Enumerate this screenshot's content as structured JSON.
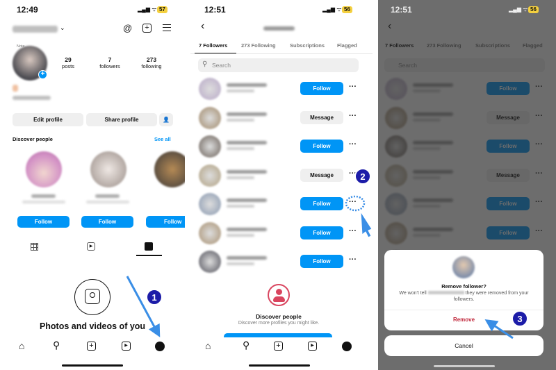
{
  "panel1": {
    "status": {
      "time": "12:49",
      "battery": "57"
    },
    "header_icons": [
      "threads-icon",
      "new-post-icon",
      "menu-icon"
    ],
    "avatar_note": "Note...",
    "stats": [
      {
        "value": "29",
        "label": "posts"
      },
      {
        "value": "7",
        "label": "followers"
      },
      {
        "value": "273",
        "label": "following"
      }
    ],
    "edit_profile": "Edit profile",
    "share_profile": "Share profile",
    "discover_title": "Discover people",
    "see_all": "See all",
    "suggestion_follow": "Follow",
    "content_tabs": [
      "grid-icon",
      "reels-icon",
      "tagged-icon"
    ],
    "tagged_empty": "Photos and videos of you",
    "step": "1"
  },
  "panel2": {
    "status": {
      "time": "12:51",
      "battery": "56"
    },
    "tabs": [
      "7 Followers",
      "273 Following",
      "Subscriptions",
      "Flagged"
    ],
    "search_placeholder": "Search",
    "followers": [
      {
        "action": "Follow"
      },
      {
        "action": "Message"
      },
      {
        "action": "Follow"
      },
      {
        "action": "Message"
      },
      {
        "action": "Follow"
      },
      {
        "action": "Follow"
      },
      {
        "action": "Follow"
      }
    ],
    "more": "···",
    "discover_title": "Discover people",
    "discover_sub": "Discover more profiles you might like.",
    "step": "2"
  },
  "panel3": {
    "status": {
      "time": "12:51",
      "battery": "56"
    },
    "dialog_title": "Remove follower?",
    "dialog_text_before": "We won't tell",
    "dialog_text_after": "they were removed from your followers.",
    "remove": "Remove",
    "cancel": "Cancel",
    "step": "3"
  },
  "colors": {
    "accent": "#0095f6",
    "danger": "#ed4956",
    "step_badge": "#1c1ca8",
    "arrow": "#3a8ee6"
  }
}
